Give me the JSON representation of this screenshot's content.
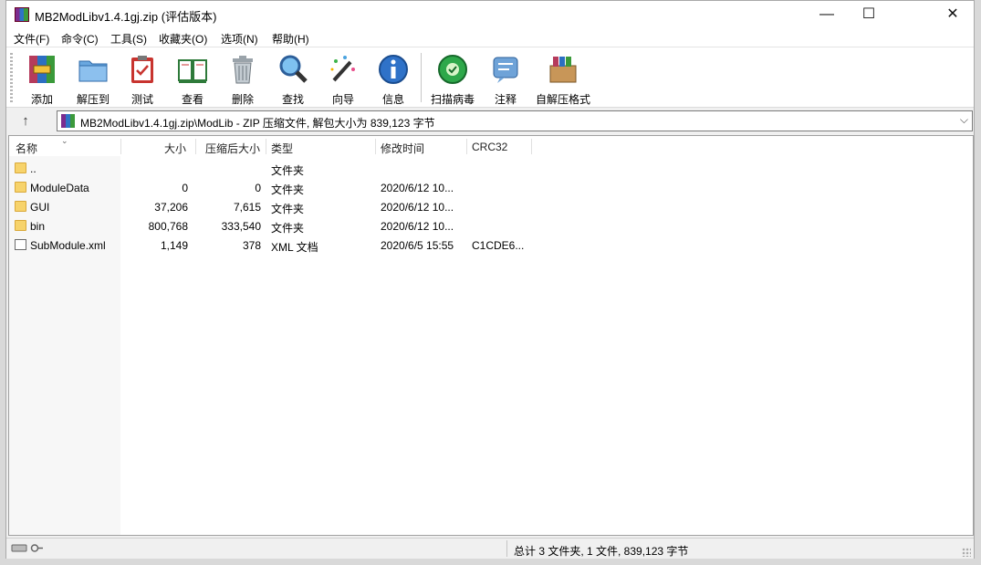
{
  "window": {
    "title": "MB2ModLibv1.4.1gj.zip (评估版本)",
    "controls": {
      "minimize": "—",
      "maximize": "☐",
      "close": "✕"
    }
  },
  "menu": [
    "文件(F)",
    "命令(C)",
    "工具(S)",
    "收藏夹(O)",
    "选项(N)",
    "帮助(H)"
  ],
  "toolbar": [
    {
      "label": "添加",
      "icon": "add-archive-icon"
    },
    {
      "label": "解压到",
      "icon": "extract-folder-icon"
    },
    {
      "label": "测试",
      "icon": "test-clipboard-icon"
    },
    {
      "label": "查看",
      "icon": "view-book-icon"
    },
    {
      "label": "删除",
      "icon": "trash-bin-icon"
    },
    {
      "label": "查找",
      "icon": "magnifier-icon"
    },
    {
      "label": "向导",
      "icon": "wizard-wand-icon"
    },
    {
      "label": "信息",
      "icon": "info-icon"
    },
    {
      "label": "扫描病毒",
      "icon": "virus-scan-icon"
    },
    {
      "label": "注释",
      "icon": "comment-icon"
    },
    {
      "label": "自解压格式",
      "icon": "sfx-box-icon"
    }
  ],
  "address": {
    "up": "↑",
    "path": "MB2ModLibv1.4.1gj.zip\\ModLib - ZIP 压缩文件, 解包大小为 839,123 字节",
    "dropdown": "⌵"
  },
  "columns": {
    "name": "名称",
    "size": "大小",
    "packed": "压缩后大小",
    "type": "类型",
    "modified": "修改时间",
    "crc": "CRC32"
  },
  "files": [
    {
      "name": "..",
      "size": "",
      "packed": "",
      "type": "文件夹",
      "modified": "",
      "crc": "",
      "kind": "folder"
    },
    {
      "name": "ModuleData",
      "size": "0",
      "packed": "0",
      "type": "文件夹",
      "modified": "2020/6/12 10...",
      "crc": "",
      "kind": "folder"
    },
    {
      "name": "GUI",
      "size": "37,206",
      "packed": "7,615",
      "type": "文件夹",
      "modified": "2020/6/12 10...",
      "crc": "",
      "kind": "folder"
    },
    {
      "name": "bin",
      "size": "800,768",
      "packed": "333,540",
      "type": "文件夹",
      "modified": "2020/6/12 10...",
      "crc": "",
      "kind": "folder"
    },
    {
      "name": "SubModule.xml",
      "size": "1,149",
      "packed": "378",
      "type": "XML 文档",
      "modified": "2020/6/5 15:55",
      "crc": "C1CDE6...",
      "kind": "xml"
    }
  ],
  "status": {
    "summary": "总计 3 文件夹, 1 文件, 839,123 字节"
  }
}
